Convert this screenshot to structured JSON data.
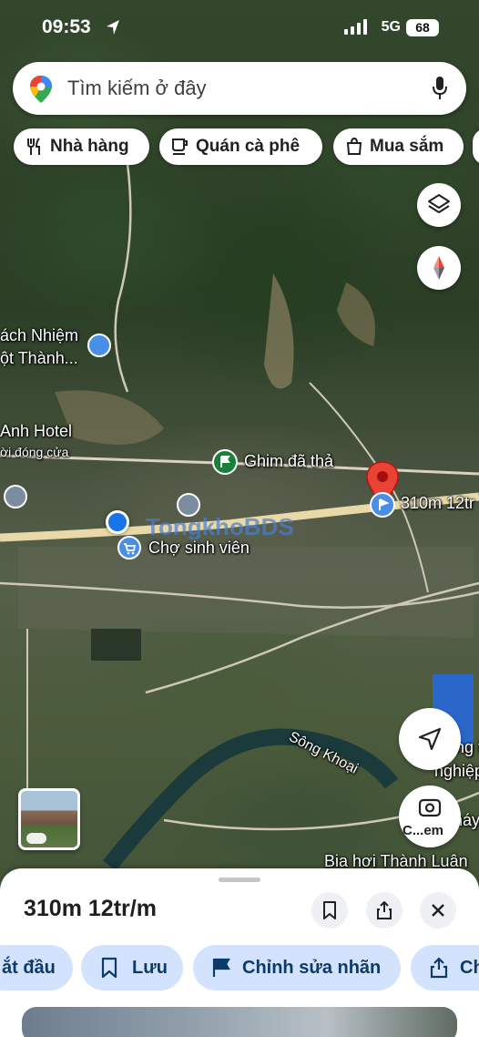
{
  "status_bar": {
    "time": "09:53",
    "network": "5G",
    "battery": "68"
  },
  "search": {
    "placeholder": "Tìm kiếm ở đây"
  },
  "chips": [
    {
      "label": "Nhà hàng",
      "icon": "restaurant-icon"
    },
    {
      "label": "Quán cà phê",
      "icon": "coffee-icon"
    },
    {
      "label": "Mua sắm",
      "icon": "shopping-bag-icon"
    }
  ],
  "map": {
    "labels": {
      "place_1": "ách Nhiệm",
      "place_1b": "ột Thành...",
      "hotel": "Anh Hotel",
      "hotel_status": "ời đóng cửa",
      "dropped_pin": "Ghim đã thả",
      "selected_pin": "310m 12tr",
      "market": "Chợ sinh viên",
      "river": "Sông Khoại",
      "industrial_1": "ng t",
      "industrial_2": "nghiệp c",
      "beer": "Bia hơi Thành Luân",
      "street_view_partial": "C...em",
      "partial_right": "háy",
      "watermark": "TongkhoBDS"
    }
  },
  "sheet": {
    "title": "310m 12tr/m",
    "actions": [
      {
        "label": "ắt đầu"
      },
      {
        "label": "Lưu",
        "icon": "bookmark-icon"
      },
      {
        "label": "Chỉnh sửa nhãn",
        "icon": "flag-icon"
      },
      {
        "label": "Ch",
        "icon": "share-icon"
      }
    ]
  },
  "colors": {
    "accent_blue": "#1a73e8",
    "pin_red": "#ea4335",
    "chip_bg": "#d3e3fd"
  }
}
